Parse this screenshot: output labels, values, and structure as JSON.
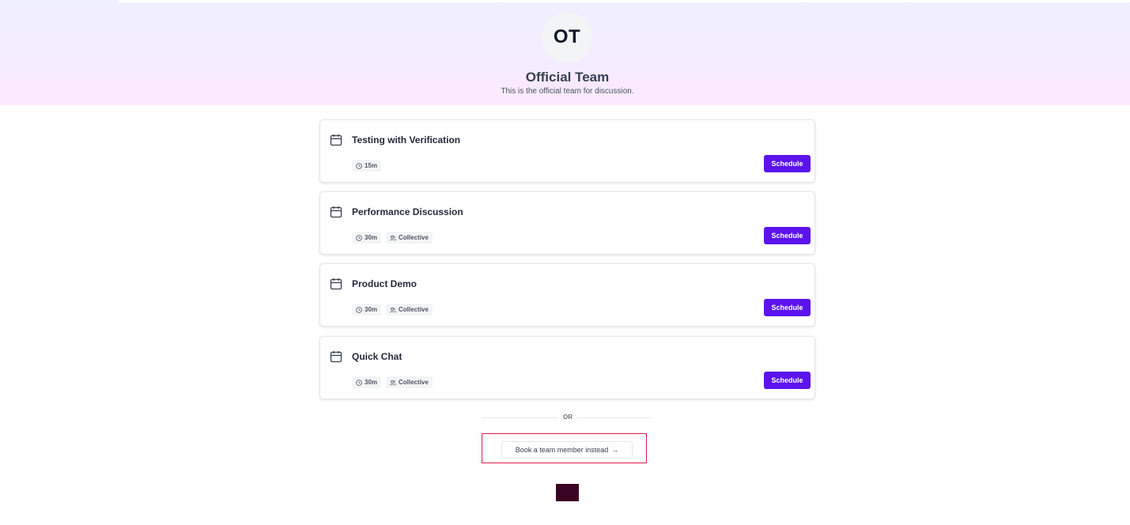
{
  "team": {
    "initials": "OT",
    "name": "Official Team",
    "description": "This is the official team for discussion."
  },
  "events": [
    {
      "title": "Testing with Verification",
      "duration": "15m",
      "type": "",
      "action": "Schedule"
    },
    {
      "title": "Performance Discussion",
      "duration": "30m",
      "type": "Collective",
      "action": "Schedule"
    },
    {
      "title": "Product Demo",
      "duration": "30m",
      "type": "Collective",
      "action": "Schedule"
    },
    {
      "title": "Quick Chat",
      "duration": "30m",
      "type": "Collective",
      "action": "Schedule"
    }
  ],
  "divider": {
    "text": "OR"
  },
  "alternate": {
    "label": "Book a team member instead",
    "arrow": "→"
  },
  "icons": {
    "event": "calendar-icon",
    "duration": "clock-icon",
    "type": "users-icon"
  },
  "colors": {
    "accent": "#5b14f0",
    "highlight": "#e11d48",
    "footer": "#3b0322"
  }
}
